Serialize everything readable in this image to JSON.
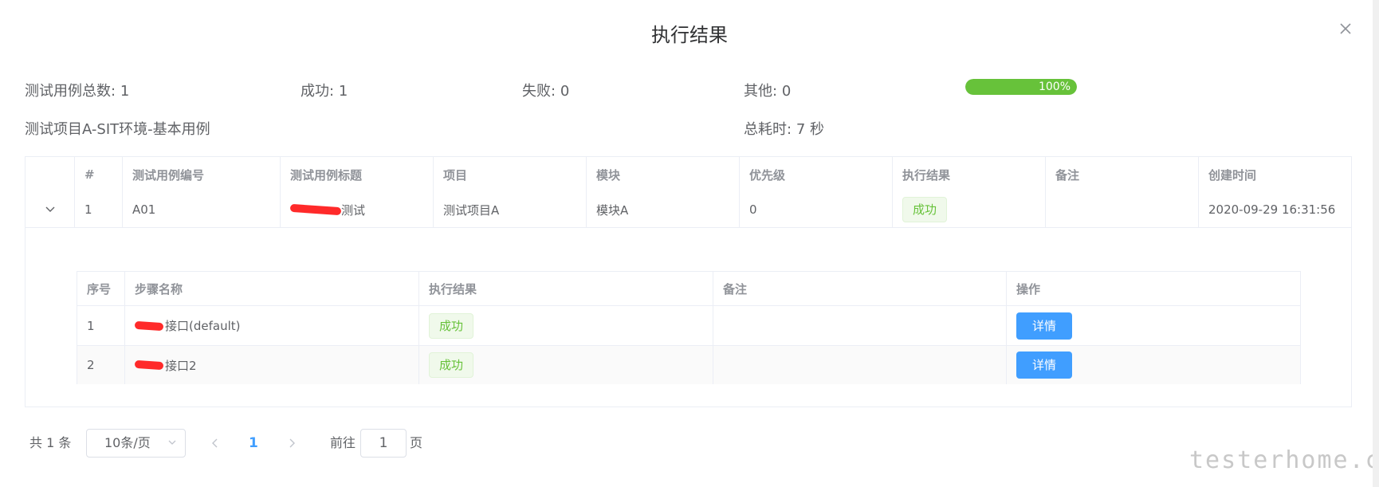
{
  "dialog": {
    "title": "执行结果"
  },
  "summary": {
    "total_label": "测试用例总数:",
    "total_value": "1",
    "success_label": "成功:",
    "success_value": "1",
    "fail_label": "失败:",
    "fail_value": "0",
    "other_label": "其他:",
    "other_value": "0",
    "progress_percent": 100,
    "progress_text": "100%",
    "suite_name": "测试项目A-SIT环境-基本用例",
    "duration_label": "总耗时:",
    "duration_value": "7 秒"
  },
  "cases_table": {
    "headers": [
      "#",
      "测试用例编号",
      "测试用例标题",
      "项目",
      "模块",
      "优先级",
      "执行结果",
      "备注",
      "创建时间"
    ],
    "rows": [
      {
        "index": "1",
        "case_id": "A01",
        "title_suffix": "测试",
        "project": "测试项目A",
        "module": "模块A",
        "priority": "0",
        "result": "成功",
        "remark": "",
        "created": "2020-09-29 16:31:56"
      }
    ]
  },
  "steps_table": {
    "headers": [
      "序号",
      "步骤名称",
      "执行结果",
      "备注",
      "操作"
    ],
    "rows": [
      {
        "index": "1",
        "name_suffix": "接口(default)",
        "result": "成功",
        "remark": "",
        "action": "详情"
      },
      {
        "index": "2",
        "name_suffix": "接口2",
        "result": "成功",
        "remark": "",
        "action": "详情"
      }
    ]
  },
  "pagination": {
    "total_text": "共 1 条",
    "page_size": "10条/页",
    "current_page": "1",
    "goto_label": "前往",
    "goto_value": "1",
    "page_suffix": "页"
  },
  "watermark": "testerhome.com",
  "colors": {
    "success": "#67c23a",
    "primary": "#409eff",
    "redaction": "#ff2a2a"
  }
}
